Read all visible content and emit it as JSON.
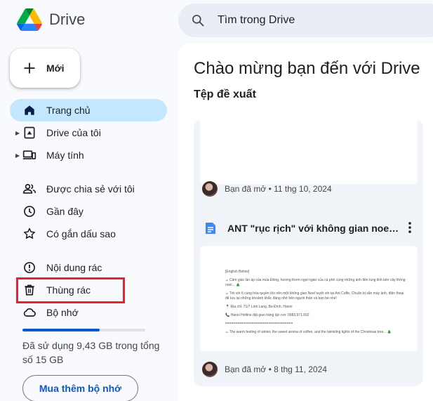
{
  "app": {
    "title": "Drive"
  },
  "search": {
    "placeholder": "Tìm trong Drive"
  },
  "new_button": {
    "label": "Mới"
  },
  "nav": {
    "home": "Trang chủ",
    "my_drive": "Drive của tôi",
    "computers": "Máy tính",
    "shared": "Được chia sẻ với tôi",
    "recent": "Gần đây",
    "starred": "Có gắn dấu sao",
    "spam": "Nội dung rác",
    "trash": "Thùng rác",
    "storage": "Bộ nhớ"
  },
  "storage": {
    "used_fraction": 0.63,
    "text": "Đã sử dụng 9,43 GB trong tổng số 15 GB",
    "buy_label": "Mua thêm bộ nhớ"
  },
  "main": {
    "welcome": "Chào mừng bạn đến với Drive",
    "suggested": "Tệp đề xuất",
    "cards": [
      {
        "meta": "Bạn đã mở • 11 thg 10, 2024"
      },
      {
        "title": "ANT \"rục rịch\" với không gian noel mớ...",
        "meta": "Bạn đã mở • 8 thg 11, 2024",
        "preview": [
          "[English Below]",
          "☕ Cảm giác lần áp của mùa Đông, hương thơm ngọt ngào của cà phê cùng những ánh đèn lung linh bên cây thông noel... 🎄",
          "☕ Tới với ổ cùng hóa quyền tôo nên một không gian Noel tuyệt vời tại Ant Coffe. Chuẩn bị sẵn máy ảnh, điện thoại để lưu lại những khoảnh khắc đáng nhớ bên người thân và bạn bè nhé!",
          "📍 Địa chỉ: 71/7 Linh Lang, Ba Đình, Hanoi",
          "📞 Hanoi Hotline đặt giao hàng tận nơi: 0983.971.692",
          "=================================",
          "☕ The warm feeling of winter, the sweet aroma of coffee, and the twinkling lights of the Christmas tree... 🎄"
        ]
      }
    ]
  },
  "colors": {
    "accent": "#0b57d0",
    "active_nav": "#c2e7ff",
    "highlight": "#e32530"
  }
}
